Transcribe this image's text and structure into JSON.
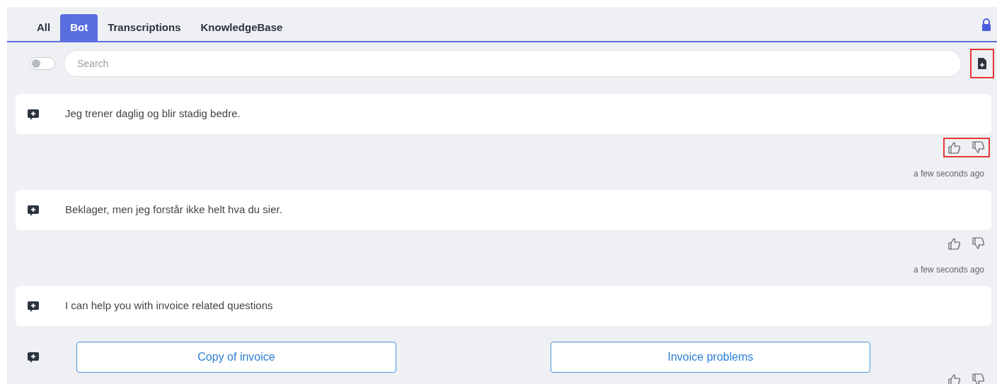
{
  "tabs": [
    {
      "label": "All",
      "selected": false
    },
    {
      "label": "Bot",
      "selected": true
    },
    {
      "label": "Transcriptions",
      "selected": false
    },
    {
      "label": "KnowledgeBase",
      "selected": false
    }
  ],
  "filter_toggle": {
    "on": false
  },
  "search": {
    "placeholder": "Search"
  },
  "new_document_button": {
    "highlighted": true
  },
  "messages": [
    {
      "kind": "text",
      "text": "Jeg trener daglig og blir stadig bedre.",
      "feedback_highlighted": true,
      "time": "a few seconds ago"
    },
    {
      "kind": "text",
      "text": "Beklager, men jeg forstår ikke helt hva du sier.",
      "feedback_highlighted": false,
      "time": "a few seconds ago"
    },
    {
      "kind": "text",
      "text": "I can help you with invoice related questions"
    },
    {
      "kind": "options",
      "options": [
        "Copy of invoice",
        "Invoice problems"
      ],
      "feedback_highlighted": false
    }
  ]
}
